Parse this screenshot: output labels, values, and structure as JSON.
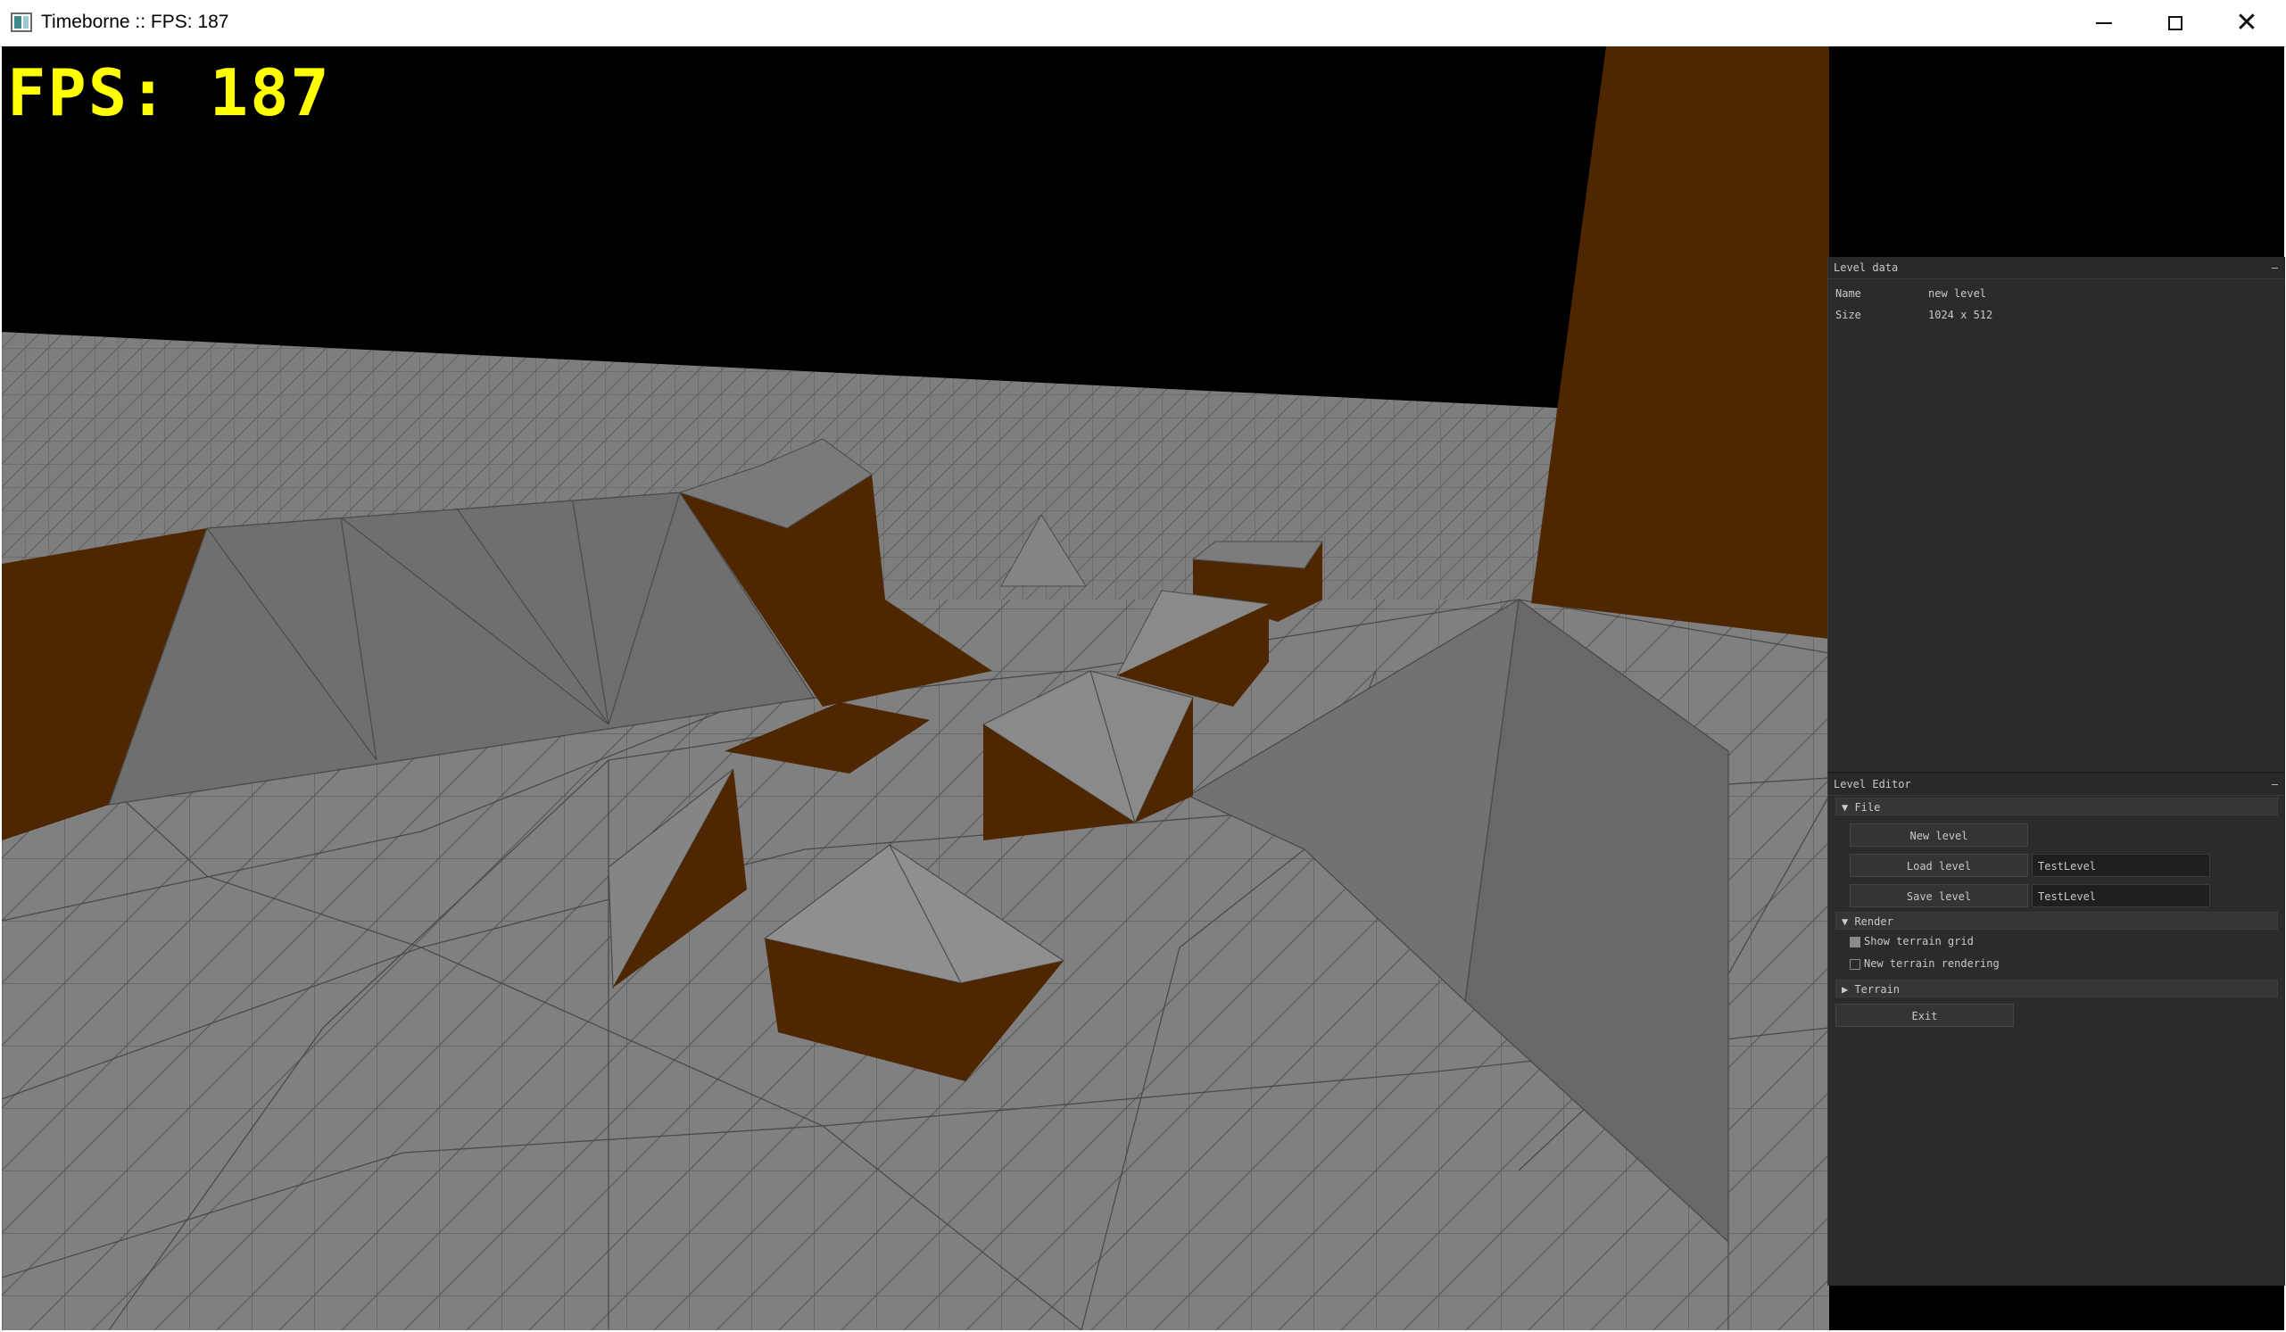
{
  "window": {
    "title": "Timeborne :: FPS: 187",
    "minimize_icon": "minimize-icon",
    "maximize_icon": "maximize-icon",
    "close_label": "✕"
  },
  "hud": {
    "fps_text": "FPS: 187",
    "color": "#ffff00"
  },
  "colors": {
    "terrain": "#7d7d7d",
    "terrain_dark": "#626262",
    "cliff": "#4e2600",
    "sky": "#000000",
    "panel_bg": "#2b2b2b"
  },
  "level_data": {
    "title": "Level data",
    "collapse": "–",
    "name_key": "Name",
    "name_value": "new level",
    "size_key": "Size",
    "size_value": "1024 x 512"
  },
  "level_editor": {
    "title": "Level Editor",
    "collapse": "–",
    "file_header": "▼ File",
    "new_level": "New level",
    "load_level": "Load level",
    "load_input": "TestLevel",
    "save_level": "Save level",
    "save_input": "TestLevel",
    "render_header": "▼ Render",
    "show_terrain_grid": "Show terrain grid",
    "show_terrain_grid_checked": true,
    "new_terrain_rendering": "New terrain rendering",
    "new_terrain_rendering_checked": false,
    "terrain_header": "▶ Terrain",
    "exit": "Exit"
  }
}
